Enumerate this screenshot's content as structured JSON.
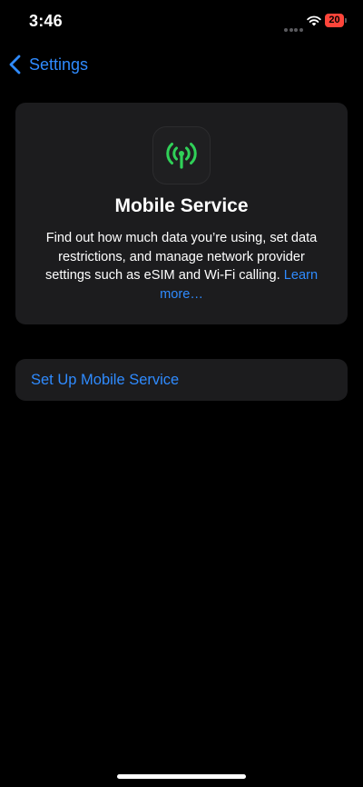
{
  "status_bar": {
    "time": "3:46",
    "battery_level": "20",
    "battery_color": "#ff453a",
    "icons": [
      "signal-dots-icon",
      "wifi-icon",
      "battery-icon"
    ]
  },
  "nav": {
    "back_label": "Settings",
    "back_icon": "chevron-left-icon"
  },
  "info_card": {
    "icon": "antenna-icon",
    "icon_color": "#30d158",
    "title": "Mobile Service",
    "description": "Find out how much data you’re using, set data restrictions, and manage network provider settings such as eSIM and Wi-Fi calling. ",
    "learn_more": "Learn more…"
  },
  "actions": {
    "setup_label": "Set Up Mobile Service"
  },
  "colors": {
    "accent": "#2f8bff",
    "background": "#000000",
    "card": "#1c1c1e"
  }
}
